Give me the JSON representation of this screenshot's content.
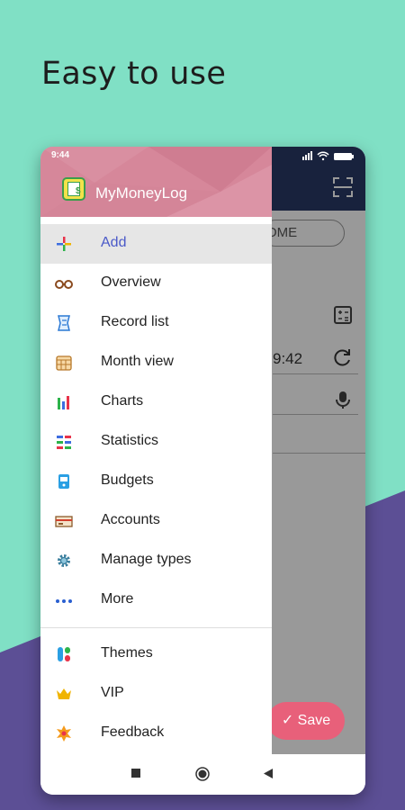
{
  "headline": "Easy to use",
  "status_bar": {
    "time": "9:44",
    "icons": "▮▮▮ ᯤ ▭"
  },
  "app": {
    "income_label": "OME",
    "time_value": "9:42",
    "save_label": "✓  Save"
  },
  "drawer": {
    "app_name": "MyMoneyLog",
    "items": [
      {
        "label": "Add",
        "icon": "plus-icon",
        "active": true
      },
      {
        "label": "Overview",
        "icon": "glasses-icon"
      },
      {
        "label": "Record list",
        "icon": "receipt-icon"
      },
      {
        "label": "Month view",
        "icon": "calendar-icon"
      },
      {
        "label": "Charts",
        "icon": "bar-chart-icon"
      },
      {
        "label": "Statistics",
        "icon": "statistics-icon"
      },
      {
        "label": "Budgets",
        "icon": "budget-icon"
      },
      {
        "label": "Accounts",
        "icon": "accounts-icon"
      },
      {
        "label": "Manage types",
        "icon": "gear-icon"
      },
      {
        "label": "More",
        "icon": "more-dots-icon"
      },
      {
        "label": "Themes",
        "icon": "themes-icon"
      },
      {
        "label": "VIP",
        "icon": "crown-icon"
      },
      {
        "label": "Feedback",
        "icon": "feedback-icon"
      }
    ]
  },
  "colors": {
    "background_mint": "#80e0c5",
    "background_purple": "#5c4f95",
    "drawer_header": "#d6879a",
    "app_toolbar": "#283966",
    "active_label": "#4a59c8"
  }
}
